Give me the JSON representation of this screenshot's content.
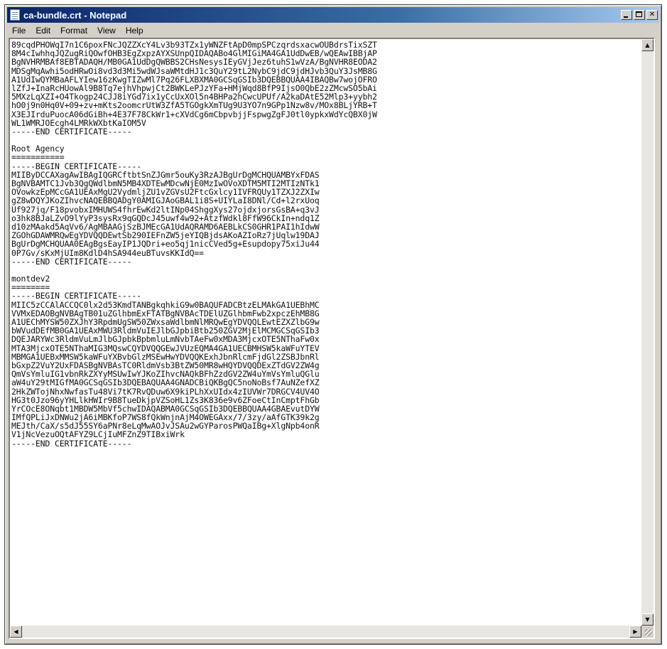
{
  "window": {
    "title": "ca-bundle.crt - Notepad",
    "minimize_glyph": "",
    "maximize_glyph": "",
    "close_glyph": "✕"
  },
  "menu": {
    "file": "File",
    "edit": "Edit",
    "format": "Format",
    "view": "View",
    "help": "Help"
  },
  "scrollbar": {
    "up_arrow": "▲",
    "down_arrow": "▼",
    "left_arrow": "◀",
    "right_arrow": "▶"
  },
  "document": {
    "lines": [
      "89cqdPHOWqI7n1C6poxFNcJQZZXcY4Lv3b93TZx1yWNZFtApD0mpSPCzqrdsxacwOUBdrsTixSZT",
      "8M4cIwhhqJQZugRiQOwfOHB3EgZxpzAYXSUnpQIDAQABo4GlMIGiMA4GA1UdDwEB/wQEAwIBBjAP",
      "BgNVHRMBAf8EBTADAQH/MB0GA1UdDgQWBBS2CHsNesysIEyGVjJez6tuhS1wVzA/BgNVHR8EODA2",
      "MDSgMqAwhi5odHRwOi8vd3d3Mi5wdWJsaWMtdHJ1c3QuY29tL2NybC9jdC9jdHJvb3QuY3JsMB8G",
      "A1UdIwQYMBaAFLYIew16zKwgTIZwMl7Pq26FLXBXMA0GCSqGSIb3DQEBBQUAA4IBAQBw7wojOFRO",
      "lZfJ+InaRcHUowAl9B8Tq7ejhVhpwjCt2BWKLePJzYFa+HMjWqd8BfP9IjsO0QbE2zZMcwSO5bAi",
      "5MXzLqXZI+O4Tkogp24CJJ8iYGd7ix1yCcUxXOl5n4BHPa2hCwcUPUf/A2kaDAtE52Mlp3+yybh2",
      "hO0j9n0Hq0V+09+zv+mKts2oomcrUtW3ZfA5TGOgkXmTUg9U3YO7n9GPp1Nzw8v/MOx8BLjYRB+T",
      "X3EJIrduPuocA06dGiBh+4E37F78CkWr1+cXVdCg6mCbpvbjjFspwgZgFJ0tl0ypkxWdYcQBX0jW",
      "WL1WMRJOEcgh4LMRkWXbtKaIOM5V",
      "-----END CERTIFICATE-----",
      "",
      "Root Agency",
      "===========",
      "-----BEGIN CERTIFICATE-----",
      "MIIByDCCAXagAwIBAgIQGRCftbtSnZJGmr5ouKy3RzAJBgUrDgMCHQUAMBYxFDAS",
      "BgNVBAMTC1Jvb3QgQWdlbmN5MB4XDTEwMDcwNjE0MzIwOVoXDTM5MTI2MTIzNTk1",
      "OVowkzEpMCcGA1UEAxMgU2VydmljZU1vZGVsU2FtcGxlcy1IVFRQUy1TZXJ2ZXIw",
      "gZ8wDQYJKoZIhvcNAQEBBQADgY0AMIGJAoGBAL1i8S+UIYLaI8DNl/Cd+l2rxUoq",
      "Uf927jq/F18pvobxIMHUWS4fhrEwKd2ltINp04ShggXys27ojdxjorsGsBA+q3vJ",
      "o3hk8BJaLZvO9lYyP3sysRx9qGQDcJ45uwf4w92+AtzfWdkl8FfW96CkIn+ndq1Z",
      "d10zMAakd5AqVv6/AgMBAAGjSzBJMEcGA1UdAQRAMD6AEBLkCS0GHR1PAI1hIdwW",
      "ZGOhGDAWMRQwEgYDVQQDEwtSb290IEFnZW5jeYIQBjdsAKoAZIoRz7jUqlw19DAJ",
      "BgUrDgMCHQUAA0EAgBgsEayIP1JQDri+eo5qj1nicCVed5g+Esupdopy75xiJu44",
      "0P7Gv/sKxMjUIm8KdlD4hSA944euBTuvsKKIdQ==",
      "-----END CERTIFICATE-----",
      "",
      "montdev2",
      "========",
      "-----BEGIN CERTIFICATE-----",
      "MIIC5zCCAlACCQC0lx2d53KmdTANBgkqhkiG9w0BAQUFADCBtzELMAkGA1UEBhMC",
      "VVMxEDAOBgNVBAgTB01uZGlhbmExFTATBgNVBAcTDElUZGlhbmFwb2xpczEhMB8G",
      "A1UEChMYSW50ZXJhY3RpdmUgSW50ZWxsaWdlbmNlMRQwEgYDVQQLEwtEZXZlbG9w",
      "bWVudDEfMB0GA1UEAxMWU3RldmVuIEJlbGJpbiBtb250ZGV2MjElMCMGCSqGSIb3",
      "DQEJARYWc3RldmVuLmJlbGJpbkBpbmluLmNvbTAeFw0xMDA3MjcxOTE5NThaFw0x",
      "MTA3MjcxOTE5NThaMIG3MQswCQYDVQQGEwJVUzEQMA4GA1UECBMHSW5kaWFuYTEV",
      "MBMGA1UEBxMMSW5kaWFuYXBvbGlzMSEwHwYDVQQKExhJbnRlcmFjdGl2ZSBJbnRl",
      "bGxpZ2VuY2UxFDASBgNVBAsTC0RldmVsb3BtZW50MR8wHQYDVQQDExZTdGV2ZW4g",
      "QmVsYmluIG1vbnRkZXYyMSUwIwYJKoZIhvcNAQkBFhZzdGV2ZW4uYmVsYmluQGlu",
      "aW4uY29tMIGfMA0GCSqGSIb3DQEBAQUAA4GNADCBiQKBgQC5noNoBsf7AuNZefXZ",
      "2HkZWTojNhxNwfasTu48Vi7tK7RvQDuw6X9kiPLhXxUIdx4zIUVWr7DRGCV4UV4O",
      "HG3t0Jzo96yYHLlkHWIr9B8TueDkjpVZSoHL1Zs3K836e9v6ZFoeCtInCmptFhGb",
      "YrCOcE8ONqbt1MBDW5MbVf5chwIDAQABMA0GCSqGSIb3DQEBBQUAA4GBAEvutDYW",
      "IMfQPLiJxDNWu2jA6iMBKfoP7WS8fQkWnjnAjM4OWEGAxx/7/3zy/aAfGTK39k2g",
      "MEJth/CaX/s5dJ55SY6aPNr8eLqMwAOJvJSAu2wGYParosPWQaIBg+XlgNpb4onR",
      "V1jNcVezuOQtAFYZ9LCjIuMFZnZ9TIBxiWrk",
      "-----END CERTIFICATE-----",
      ""
    ]
  }
}
